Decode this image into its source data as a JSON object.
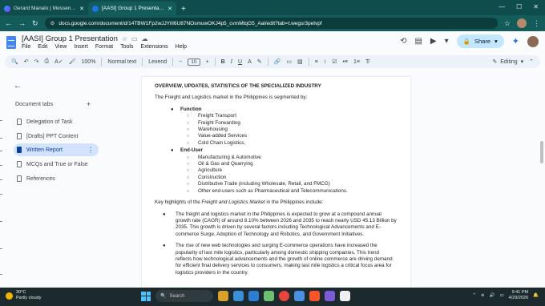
{
  "browser": {
    "tabs": [
      {
        "title": "Gerard Manalo | Messenger",
        "active": false
      },
      {
        "title": "[AASI] Group 1 Presentation - G",
        "active": true
      }
    ],
    "url": "docs.google.com/document/d/14TBW1Fp2wJJYiII6U87NOsmuwOKJ4p5_cvmMtqG5_Aal/edit?tab=t.wegsr3petvpf"
  },
  "doc": {
    "title": "[AASI] Group 1 Presentation",
    "menus": [
      "File",
      "Edit",
      "View",
      "Insert",
      "Format",
      "Tools",
      "Extensions",
      "Help"
    ],
    "share_label": "Share"
  },
  "toolbar": {
    "zoom": "100%",
    "style": "Normal text",
    "font": "Lexend",
    "size": "10",
    "mode": "Editing"
  },
  "sidebar": {
    "heading": "Document tabs",
    "items": [
      {
        "label": "Delegation of Task"
      },
      {
        "label": "[Drafts] PPT Content"
      },
      {
        "label": "Written Report"
      },
      {
        "label": "MCQs and True or False"
      },
      {
        "label": "References"
      }
    ]
  },
  "page": {
    "heading": "OVERVIEW, UPDATES, STATISTICS OF THE SPECIALIZED INDUSTRY",
    "intro": "The Freight and Logistics market in the Philippines is segmented by:",
    "function_label": "Function",
    "function_items": [
      "Freight Transport",
      "Freight Forwarding",
      "Warehousing",
      "Value-added Services",
      "Cold Chain Logistics,"
    ],
    "enduser_label": "End-User",
    "enduser_items": [
      "Manufacturing & Automotive",
      "Oil & Gas and Quarrying",
      "Agriculture",
      "Construction",
      "Distributive Trade (including Wholesale, Retail, and FMCG)",
      "Other end-users such as Pharmaceutical and Telecommunications."
    ],
    "highlights_pre": "Key highlights of the ",
    "highlights_em": "Freight and Logistics Market",
    "highlights_post": " in the Philippines include:",
    "bullet1": "The freight and logistics market in the Philippines is expected to grow at a compound annual growth rate (CAGR) of around 8.10% between 2026 and 2035 to reach nearly USD 45.13 Billion by 2035. This growth is driven by several factors including Technological Advancements and E-commerce Surge, Adoption of Technology and Robotics, and Government Initiatives.",
    "bullet2": "The rise of new web technologies and surging E-commerce operations have increased the popularity of last mile logistics, particularly among domestic shipping companies. This trend reflects how technological advancements and the growth of online commerce are driving demand for efficient final delivery services to consumers, making last mile logistics a critical focus area for logistics providers in the country."
  },
  "taskbar": {
    "temp": "30°C",
    "weather": "Partly cloudy",
    "search": "Search",
    "time": "9:41 PM",
    "date": "4/29/2026"
  }
}
